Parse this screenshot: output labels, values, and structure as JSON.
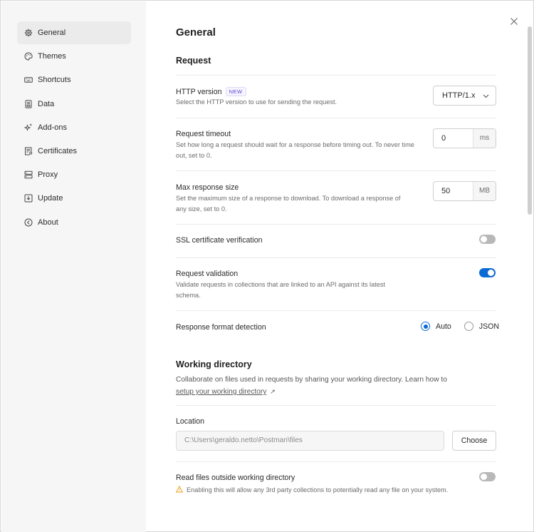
{
  "sidebar": {
    "items": [
      {
        "label": "General",
        "icon": "gear-icon"
      },
      {
        "label": "Themes",
        "icon": "palette-icon"
      },
      {
        "label": "Shortcuts",
        "icon": "keyboard-icon"
      },
      {
        "label": "Data",
        "icon": "data-icon"
      },
      {
        "label": "Add-ons",
        "icon": "sparkle-icon"
      },
      {
        "label": "Certificates",
        "icon": "certificate-icon"
      },
      {
        "label": "Proxy",
        "icon": "proxy-icon"
      },
      {
        "label": "Update",
        "icon": "download-icon"
      },
      {
        "label": "About",
        "icon": "info-icon"
      }
    ],
    "active": "General"
  },
  "page": {
    "title": "General"
  },
  "request": {
    "title": "Request",
    "http_version": {
      "label": "HTTP version",
      "badge": "NEW",
      "description": "Select the HTTP version to use for sending the request.",
      "value": "HTTP/1.x"
    },
    "timeout": {
      "label": "Request timeout",
      "description": "Set how long a request should wait for a response before timing out. To never time out, set to 0.",
      "value": "0",
      "unit": "ms"
    },
    "max_response": {
      "label": "Max response size",
      "description": "Set the maximum size of a response to download. To download a response of any size, set to 0.",
      "value": "50",
      "unit": "MB"
    },
    "ssl": {
      "label": "SSL certificate verification",
      "enabled": false
    },
    "validation": {
      "label": "Request validation",
      "description": "Validate requests in collections that are linked to an API against its latest schema.",
      "enabled": true
    },
    "format_detection": {
      "label": "Response format detection",
      "options": [
        "Auto",
        "JSON"
      ],
      "selected": "Auto"
    }
  },
  "working_directory": {
    "title": "Working directory",
    "description": "Collaborate on files used in requests by sharing your working directory. Learn how to",
    "link_text": "setup your working directory",
    "link_arrow": "↗",
    "location_label": "Location",
    "location_value": "C:\\Users\\geraldo.netto\\Postman\\files",
    "choose_label": "Choose",
    "read_outside": {
      "label": "Read files outside working directory",
      "warning": "Enabling this will allow any 3rd party collections to potentially read any file on your system.",
      "enabled": false
    }
  },
  "colors": {
    "accent": "#0b6ad3",
    "sidebar_bg": "#f6f6f6",
    "warning": "#e8a317"
  }
}
